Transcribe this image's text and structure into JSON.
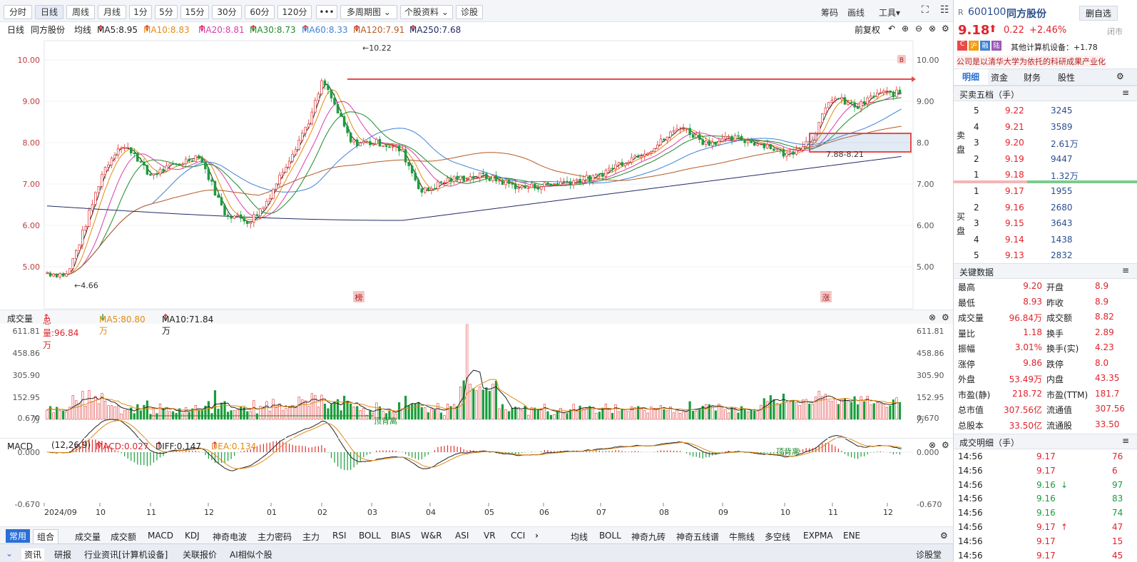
{
  "toolbar": {
    "periods": [
      "分时",
      "日线",
      "周线",
      "月线",
      "1分",
      "5分",
      "15分",
      "30分",
      "60分",
      "120分"
    ],
    "more": "•••",
    "multi": "多周期图",
    "stock_info": "个股资料",
    "diagnose": "诊股",
    "right": [
      "筹码",
      "画线",
      "工具"
    ]
  },
  "kbar": {
    "period": "日线",
    "name": "同方股份",
    "avg": "均线",
    "ma5": "MA5:8.95",
    "ma10": "MA10:8.83",
    "ma20": "MA20:8.81",
    "ma30": "MA30:8.73",
    "ma60": "MA60:8.33",
    "ma120": "MA120:7.91",
    "ma250": "MA250:7.68",
    "adj": "前复权"
  },
  "colors": {
    "ma5": "#222222",
    "ma10": "#e38a12",
    "ma20": "#d83ea6",
    "ma30": "#1d8b2a",
    "ma60": "#3d82d6",
    "ma120": "#b55a24",
    "ma250": "#222a66",
    "up": "#e03030",
    "down": "#1a9d3b"
  },
  "annotations": {
    "high": "←10.22",
    "low": "←4.66",
    "range": "7.88-8.21",
    "bang": "榜",
    "zhang": "涨",
    "b": "B",
    "top_div1": "顶背离",
    "top_div2": "顶背离"
  },
  "price_axis": {
    "left": [
      "10.00",
      "9.00",
      "8.00",
      "7.00",
      "6.00",
      "5.00"
    ],
    "right": [
      "10.00",
      "9.00",
      "8.0",
      "7.00",
      "6.00",
      "5.00"
    ]
  },
  "volume": {
    "label": "成交量",
    "total": "总量:96.84万",
    "ma5": "MA5:80.80万",
    "ma10": "MA10:71.84万",
    "axis": [
      "611.81",
      "458.86",
      "305.90",
      "152.95",
      "万"
    ]
  },
  "macd": {
    "label": "MACD",
    "params": "(12,26,9)",
    "macd": "MACD:0.027",
    "diff": "DIFF:0.147",
    "dea": "DEA:0.134",
    "axis": [
      "0.670",
      "0.000",
      "-0.670"
    ]
  },
  "x_axis": [
    "2024/09",
    "10",
    "11",
    "12",
    "01",
    "02",
    "03",
    "04",
    "05",
    "06",
    "07",
    "08",
    "09",
    "10",
    "11",
    "12"
  ],
  "bottom_tabs": {
    "left": [
      "常用",
      "组合"
    ],
    "indicators": [
      "成交量",
      "成交额",
      "MACD",
      "KDJ",
      "神奇电波",
      "主力密码",
      "主力",
      "RSI",
      "BOLL",
      "BIAS",
      "W&R",
      "ASI",
      "VR",
      "CCI"
    ],
    "right": [
      "均线",
      "BOLL",
      "神奇九砖",
      "神奇五线谱",
      "牛熊线",
      "多空线",
      "EXPMA",
      "ENE"
    ]
  },
  "news_tabs": [
    "资讯",
    "研报",
    "行业资讯[计算机设备]",
    "关联报价",
    "AI相似个股"
  ],
  "news_right": "诊股堂",
  "quote": {
    "code": "600100",
    "name": "同方股份",
    "prefix": "R",
    "btn": "删自选",
    "price": "9.18",
    "change": "0.22",
    "pct": "+2.46%",
    "status": "闭市",
    "industry": "其他计算机设备：+1.78",
    "desc": "公司是以清华大学为依托的科研成果产业化",
    "tabs": [
      "明细",
      "资金",
      "财务",
      "股性"
    ]
  },
  "orderbook": {
    "title": "买卖五档（手）",
    "sell_label": "卖盘",
    "buy_label": "买盘",
    "sell": [
      {
        "lv": "5",
        "p": "9.22",
        "v": "3245"
      },
      {
        "lv": "4",
        "p": "9.21",
        "v": "3589"
      },
      {
        "lv": "3",
        "p": "9.20",
        "v": "2.61万"
      },
      {
        "lv": "2",
        "p": "9.19",
        "v": "9447"
      },
      {
        "lv": "1",
        "p": "9.18",
        "v": "1.32万"
      }
    ],
    "buy": [
      {
        "lv": "1",
        "p": "9.17",
        "v": "1955"
      },
      {
        "lv": "2",
        "p": "9.16",
        "v": "2680"
      },
      {
        "lv": "3",
        "p": "9.15",
        "v": "3643"
      },
      {
        "lv": "4",
        "p": "9.14",
        "v": "1438"
      },
      {
        "lv": "5",
        "p": "9.13",
        "v": "2832"
      }
    ]
  },
  "key": {
    "title": "关键数据",
    "rows": [
      [
        "最高",
        "9.20",
        "开盘",
        "8.9"
      ],
      [
        "最低",
        "8.93",
        "昨收",
        "8.9"
      ],
      [
        "成交量",
        "96.84万",
        "成交额",
        "8.82"
      ],
      [
        "量比",
        "1.18",
        "换手",
        "2.89"
      ],
      [
        "振幅",
        "3.01%",
        "换手(实)",
        "4.23"
      ],
      [
        "涨停",
        "9.86",
        "跌停",
        "8.0"
      ],
      [
        "外盘",
        "53.49万",
        "内盘",
        "43.35"
      ],
      [
        "市盈(静)",
        "218.72",
        "市盈(TTM)",
        "181.7"
      ],
      [
        "总市值",
        "307.56亿",
        "流通值",
        "307.56"
      ],
      [
        "总股本",
        "33.50亿",
        "流通股",
        "33.50"
      ]
    ]
  },
  "trades": {
    "title": "成交明细（手）",
    "rows": [
      [
        "14:56",
        "9.17",
        "76"
      ],
      [
        "14:56",
        "9.17",
        "6"
      ],
      [
        "14:56",
        "9.16",
        "97"
      ],
      [
        "14:56",
        "9.16",
        "83"
      ],
      [
        "14:56",
        "9.16",
        "74"
      ],
      [
        "14:56",
        "9.17",
        "47"
      ],
      [
        "14:56",
        "9.17",
        "15"
      ],
      [
        "14:56",
        "9.17",
        "45"
      ]
    ]
  }
}
